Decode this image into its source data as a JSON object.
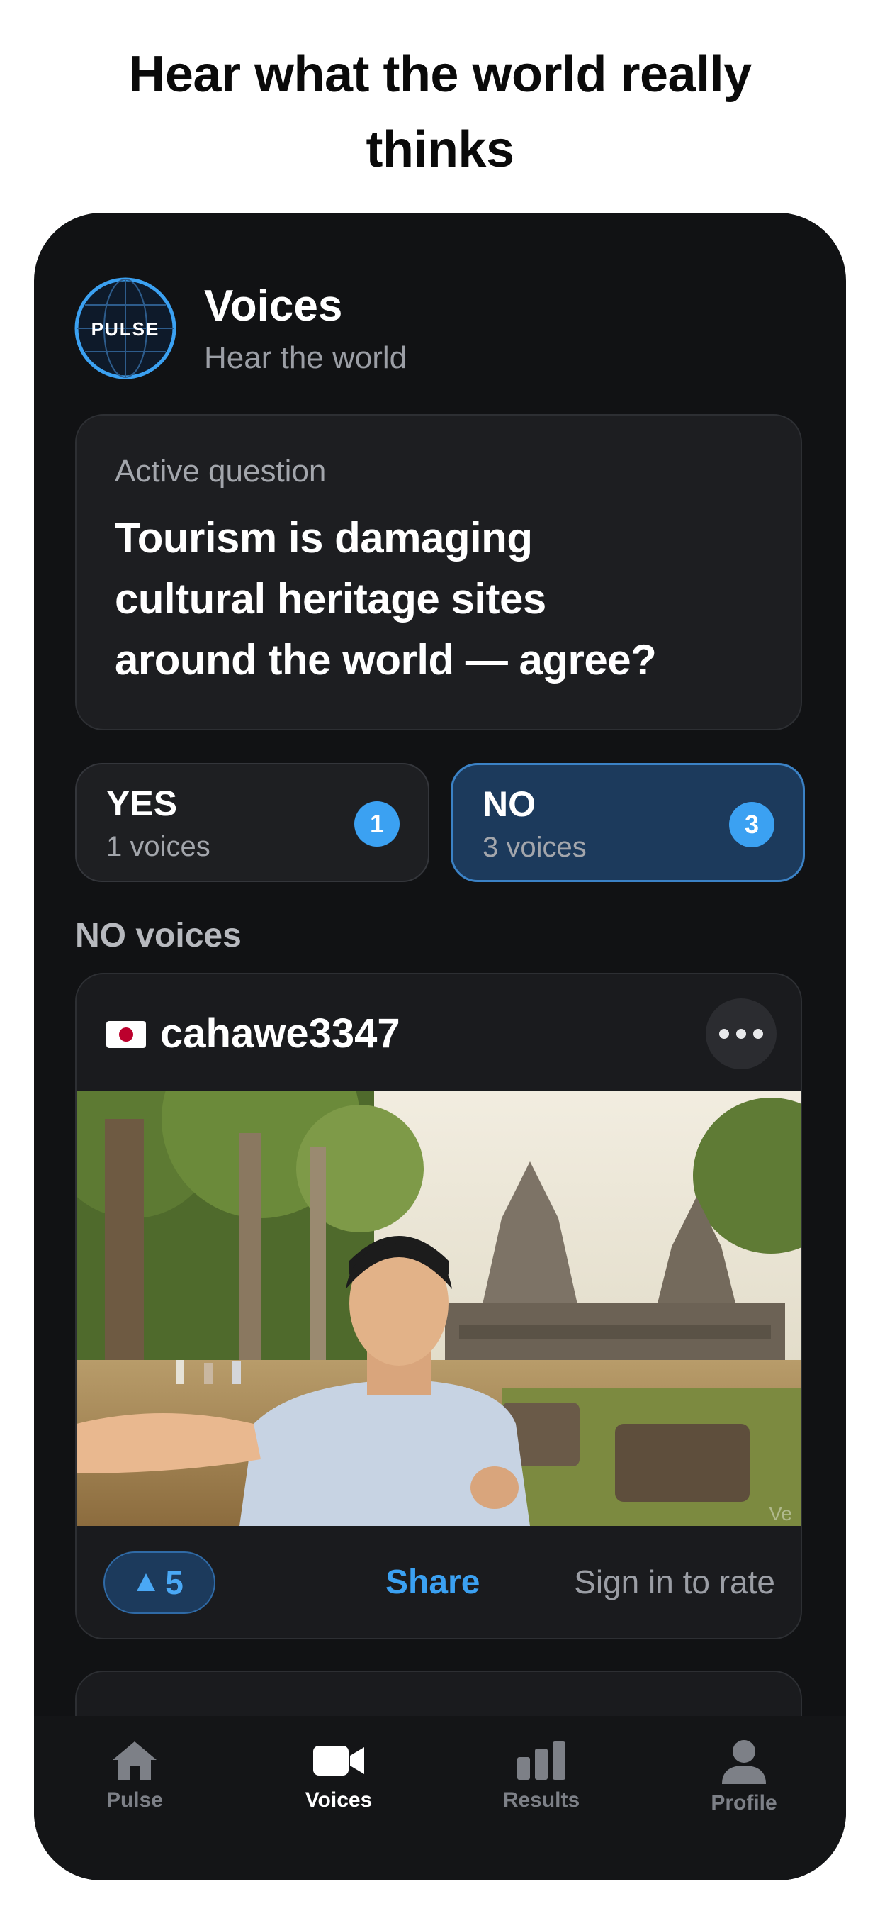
{
  "headline": {
    "line1": "Hear what the world really",
    "line2": "thinks"
  },
  "header": {
    "logo_text": "PULSE",
    "title": "Voices",
    "subtitle": "Hear the world"
  },
  "question": {
    "label": "Active question",
    "lines": [
      "Tourism is damaging",
      "cultural heritage sites",
      "around the world — agree?"
    ]
  },
  "votes": [
    {
      "label": "YES",
      "count_text": "1 voices",
      "badge": "1",
      "selected": false
    },
    {
      "label": "NO",
      "count_text": "3 voices",
      "badge": "3",
      "selected": true
    }
  ],
  "section_title": "NO voices",
  "post": {
    "flag": "japan-flag-icon",
    "username": "cahawe3347",
    "upvotes": "5",
    "share_label": "Share",
    "rate_label": "Sign in to rate"
  },
  "tabs": [
    {
      "label": "Pulse",
      "icon": "home-icon",
      "active": false
    },
    {
      "label": "Voices",
      "icon": "video-camera-icon",
      "active": true
    },
    {
      "label": "Results",
      "icon": "bar-chart-icon",
      "active": false
    },
    {
      "label": "Profile",
      "icon": "person-icon",
      "active": false
    }
  ],
  "colors": {
    "accent": "#3ba1f2",
    "background": "#111214",
    "selected_vote": "#1c3a5c"
  }
}
